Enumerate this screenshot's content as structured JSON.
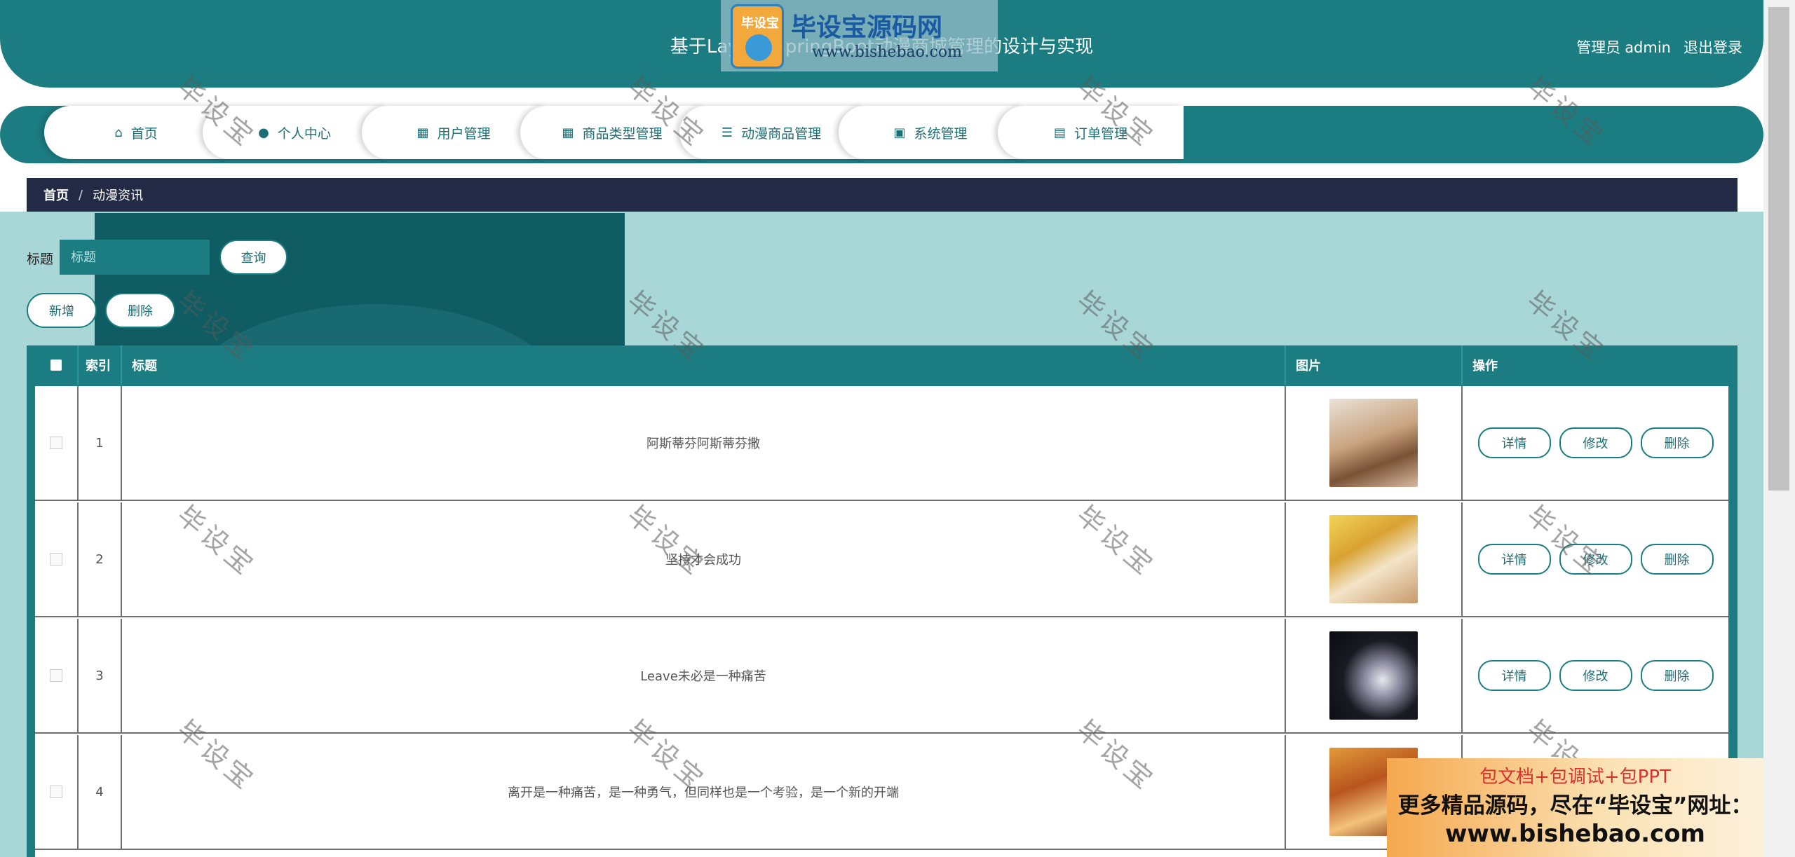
{
  "header": {
    "title": "基于Layui和SpringBoot动漫商城管理的设计与实现",
    "user_role": "管理员",
    "username": "admin",
    "logout_label": "退出登录"
  },
  "logo": {
    "badge_text": "毕设宝",
    "brand": "毕设宝源码网",
    "url": "www.bishebao.com"
  },
  "nav": {
    "items": [
      {
        "label": "首页",
        "icon": "home-icon"
      },
      {
        "label": "个人中心",
        "icon": "user-icon"
      },
      {
        "label": "用户管理",
        "icon": "grid-icon"
      },
      {
        "label": "商品类型管理",
        "icon": "grid-icon"
      },
      {
        "label": "动漫商品管理",
        "icon": "list-icon"
      },
      {
        "label": "系统管理",
        "icon": "wallet-icon"
      },
      {
        "label": "订单管理",
        "icon": "chat-icon"
      }
    ]
  },
  "breadcrumb": {
    "home": "首页",
    "separator": "/",
    "current": "动漫资讯"
  },
  "search": {
    "label": "标题",
    "placeholder": "标题",
    "query_label": "查询"
  },
  "actions": {
    "add_label": "新增",
    "delete_label": "删除"
  },
  "table": {
    "headers": {
      "index": "索引",
      "title": "标题",
      "image": "图片",
      "operation": "操作"
    },
    "op_labels": {
      "detail": "详情",
      "edit": "修改",
      "delete": "删除"
    },
    "rows": [
      {
        "index": "1",
        "title": "阿斯蒂芬阿斯蒂芬撒"
      },
      {
        "index": "2",
        "title": "坚持才会成功"
      },
      {
        "index": "3",
        "title": "Leave未必是一种痛苦"
      },
      {
        "index": "4",
        "title": "离开是一种痛苦，是一种勇气，但同样也是一个考验，是一个新的开端"
      }
    ]
  },
  "watermark": "毕设宝",
  "ad": {
    "line1": "包文档+包调试+包PPT",
    "line2": "更多精品源码，尽在“毕设宝”网址：",
    "line3": "www.bishebao.com"
  },
  "colors": {
    "primary": "#1b7c81",
    "breadcrumb_bg": "#232a45",
    "content_bg": "#a9d7d8"
  }
}
